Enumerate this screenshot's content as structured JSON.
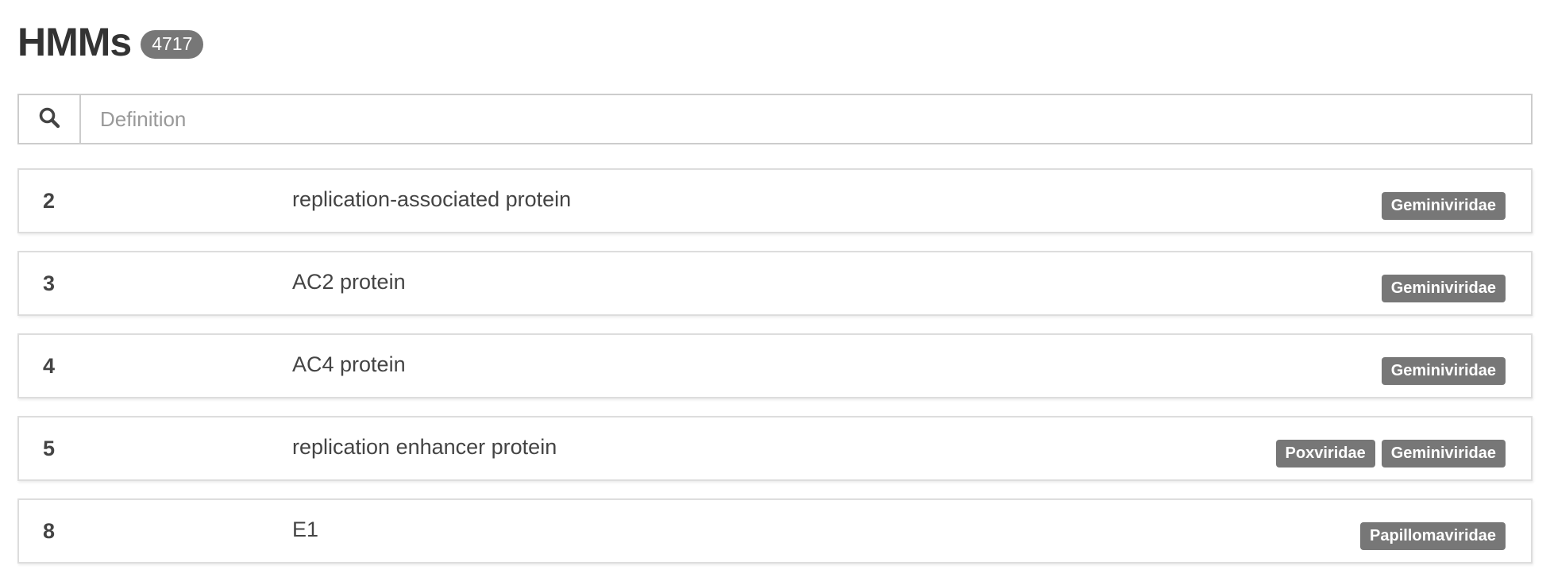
{
  "header": {
    "title": "HMMs",
    "count": "4717"
  },
  "search": {
    "placeholder": "Definition",
    "value": "",
    "icon": "search-icon"
  },
  "rows": [
    {
      "id": "2",
      "definition": "replication-associated protein",
      "tags": [
        "Geminiviridae"
      ]
    },
    {
      "id": "3",
      "definition": "AC2 protein",
      "tags": [
        "Geminiviridae"
      ]
    },
    {
      "id": "4",
      "definition": "AC4 protein",
      "tags": [
        "Geminiviridae"
      ]
    },
    {
      "id": "5",
      "definition": "replication enhancer protein",
      "tags": [
        "Poxviridae",
        "Geminiviridae"
      ]
    },
    {
      "id": "8",
      "definition": "E1",
      "tags": [
        "Papillomaviridae"
      ]
    }
  ],
  "colors": {
    "badge": "#777777",
    "border": "#dddddd",
    "text": "#333333"
  }
}
